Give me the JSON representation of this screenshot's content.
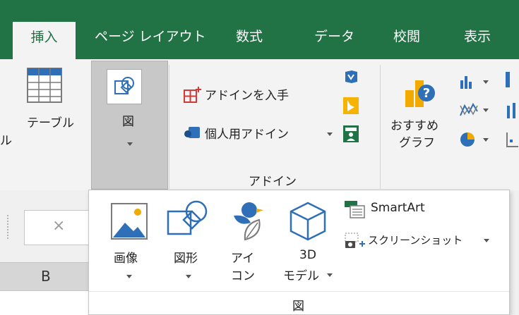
{
  "tabs": [
    {
      "label": "挿入",
      "active": true
    },
    {
      "label": "ページ レイアウト"
    },
    {
      "label": "数式"
    },
    {
      "label": "データ"
    },
    {
      "label": "校閲"
    },
    {
      "label": "表示"
    }
  ],
  "ribbon": {
    "table_label_left": "ル",
    "table_label": "テーブル",
    "picture_label": "図",
    "addins": {
      "get_addins": "アドインを入手",
      "personal_addins": "個人用アドイン",
      "group_label": "アドイン"
    },
    "recommended_charts_line1": "おすすめ",
    "recommended_charts_line2": "グラフ"
  },
  "namebox_cancel": "×",
  "column_header": "B",
  "dropdown": {
    "image_label": "画像",
    "shapes_label": "図形",
    "icons_line1": "アイ",
    "icons_line2": "コン",
    "model3d_line1": "3D",
    "model3d_line2": "モデル",
    "smartart_label": "SmartArt",
    "screenshot_label": "スクリーンショット",
    "group_label": "図"
  },
  "colors": {
    "tab_bar": "#217346",
    "accent_red": "#d23a3a",
    "icon_blue": "#2e6fb7"
  }
}
